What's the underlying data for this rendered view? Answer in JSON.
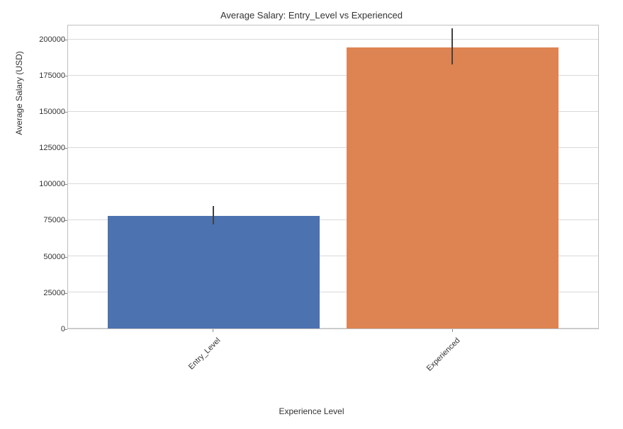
{
  "chart_data": {
    "type": "bar",
    "title": "Average Salary: Entry_Level vs Experienced",
    "xlabel": "Experience Level",
    "ylabel": "Average Salary (USD)",
    "categories": [
      "Entry_Level",
      "Experienced"
    ],
    "values": [
      78000,
      195000
    ],
    "error_ranges": [
      [
        72000,
        85000
      ],
      [
        183000,
        208000
      ]
    ],
    "ylim": [
      0,
      210000
    ],
    "yticks": [
      0,
      25000,
      50000,
      75000,
      100000,
      125000,
      150000,
      175000,
      200000
    ],
    "colors": [
      "#4c72b0",
      "#dd8452"
    ]
  }
}
